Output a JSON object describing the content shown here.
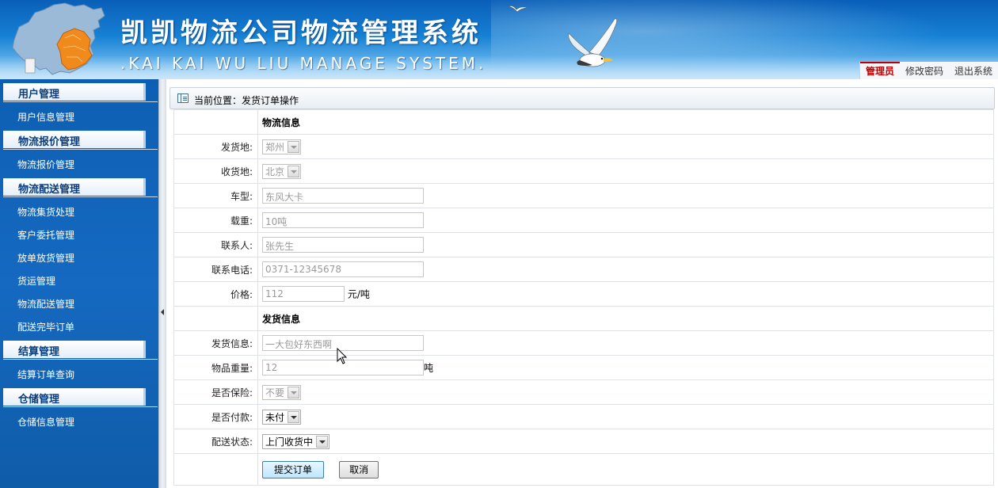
{
  "header": {
    "title": "凯凯物流公司物流管理系统",
    "subtitle": ".KAI KAI WU LIU MANAGE SYSTEM."
  },
  "user_nav": {
    "role": "管理员",
    "change_password": "修改密码",
    "logout": "退出系统"
  },
  "sidebar": {
    "sections": [
      {
        "title": "用户管理",
        "items": [
          "用户信息管理"
        ]
      },
      {
        "title": "物流报价管理",
        "items": [
          "物流报价管理"
        ]
      },
      {
        "title": "物流配送管理",
        "items": [
          "物流集货处理",
          "客户委托管理",
          "放单放货管理",
          "货运管理",
          "物流配送管理",
          "配送完毕订单"
        ]
      },
      {
        "title": "结算管理",
        "items": [
          "结算订单查询"
        ]
      },
      {
        "title": "仓储管理",
        "items": [
          "仓储信息管理"
        ]
      }
    ]
  },
  "breadcrumb": {
    "text": "当前位置：发货订单操作"
  },
  "form": {
    "section_logistics": "物流信息",
    "origin": {
      "label": "发货地:",
      "value": "郑州"
    },
    "destination": {
      "label": "收货地:",
      "value": "北京"
    },
    "vehicle_type": {
      "label": "车型:",
      "value": "东风大卡"
    },
    "load_capacity": {
      "label": "载重:",
      "value": "10吨"
    },
    "contact": {
      "label": "联系人:",
      "value": "张先生"
    },
    "phone": {
      "label": "联系电话:",
      "value": "0371-12345678"
    },
    "price": {
      "label": "价格:",
      "value": "112",
      "unit": "元/吨"
    },
    "section_shipment": "发货信息",
    "shipment_info": {
      "label": "发货信息:",
      "value": "一大包好东西啊"
    },
    "goods_weight": {
      "label": "物品重量:",
      "value": "12",
      "unit": "吨"
    },
    "insurance": {
      "label": "是否保险:",
      "value": "不要"
    },
    "paid": {
      "label": "是否付款:",
      "value": "未付"
    },
    "delivery_status": {
      "label": "配送状态:",
      "value": "上门收货中"
    },
    "submit_label": "提交订单",
    "cancel_label": "取消"
  },
  "colors": {
    "header_blue": "#1580d4",
    "sidebar_blue": "#1569c0",
    "active_red": "#c00000",
    "menu_header_text": "#0a3d7a"
  }
}
